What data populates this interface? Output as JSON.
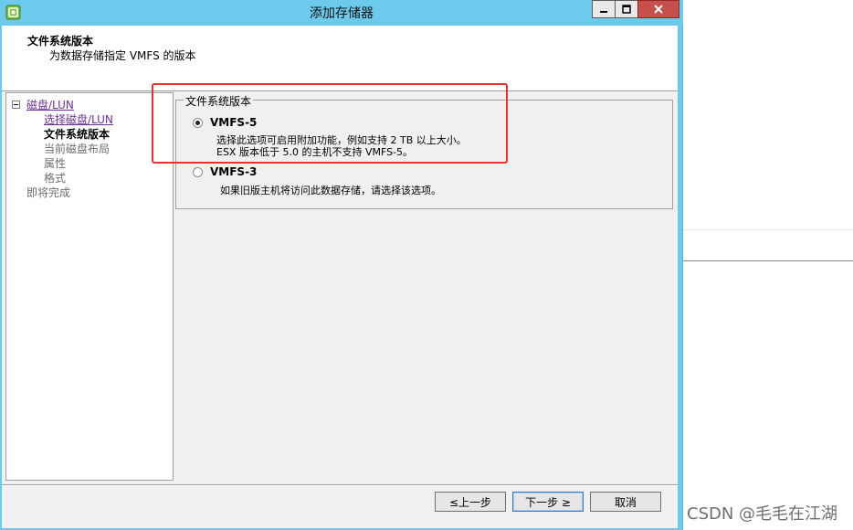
{
  "window": {
    "title": "添加存储器"
  },
  "header": {
    "title": "文件系统版本",
    "subtitle": "为数据存储指定 VMFS 的版本"
  },
  "nav": {
    "items": [
      {
        "label": "磁盘/LUN",
        "state": "link"
      },
      {
        "label": "选择磁盘/LUN",
        "state": "link"
      },
      {
        "label": "文件系统版本",
        "state": "current"
      },
      {
        "label": "当前磁盘布局",
        "state": "disabled"
      },
      {
        "label": "属性",
        "state": "disabled"
      },
      {
        "label": "格式",
        "state": "disabled"
      },
      {
        "label": "即将完成",
        "state": "disabled"
      }
    ]
  },
  "group": {
    "label": "文件系统版本",
    "options": [
      {
        "label": "VMFS-5",
        "checked": true,
        "desc_line1": "选择此选项可启用附加功能，例如支持 2 TB 以上大小。",
        "desc_line2": "ESX 版本低于 5.0 的主机不支持 VMFS-5。"
      },
      {
        "label": "VMFS-3",
        "checked": false,
        "desc_line1": "如果旧版主机将访问此数据存储，请选择该选项。"
      }
    ]
  },
  "footer": {
    "back_label": "≤上一步",
    "next_label": "下一步 ≥",
    "cancel_label": "取消"
  },
  "watermark": "CSDN @毛毛在江湖",
  "colors": {
    "titlebar": "#6ccaec",
    "close_button": "#c7504b",
    "highlight": "#e3342f",
    "link": "#7030a0"
  }
}
